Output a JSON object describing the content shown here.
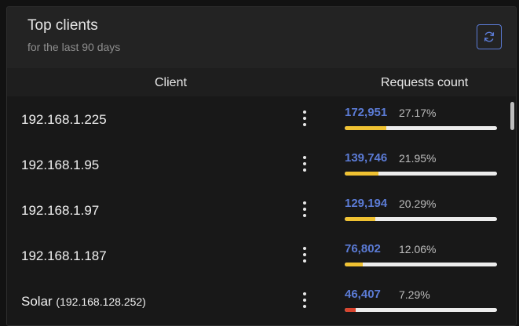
{
  "card": {
    "title": "Top clients",
    "subtitle": "for the last 90 days",
    "refresh_icon": "refresh-icon"
  },
  "table": {
    "columns": [
      "Client",
      "Requests count"
    ],
    "rows": [
      {
        "name": "192.168.1.225",
        "ip": "",
        "count": "172,951",
        "percent": "27.17%",
        "fill": 0.2717,
        "bar_color": "#f0c232"
      },
      {
        "name": "192.168.1.95",
        "ip": "",
        "count": "139,746",
        "percent": "21.95%",
        "fill": 0.2195,
        "bar_color": "#f0c232"
      },
      {
        "name": "192.168.1.97",
        "ip": "",
        "count": "129,194",
        "percent": "20.29%",
        "fill": 0.2029,
        "bar_color": "#f0c232"
      },
      {
        "name": "192.168.1.187",
        "ip": "",
        "count": "76,802",
        "percent": "12.06%",
        "fill": 0.1206,
        "bar_color": "#f0c232"
      },
      {
        "name": "Solar",
        "ip": "(192.168.128.252)",
        "count": "46,407",
        "percent": "7.29%",
        "fill": 0.0729,
        "bar_color": "#d9452f"
      }
    ]
  },
  "colors": {
    "accent": "#5b7bd5",
    "bar_track": "#ececec"
  }
}
